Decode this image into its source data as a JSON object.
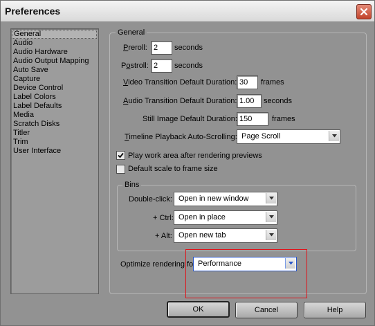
{
  "window": {
    "title": "Preferences"
  },
  "categories": [
    {
      "label": "General",
      "selected": true
    },
    {
      "label": "Audio"
    },
    {
      "label": "Audio Hardware"
    },
    {
      "label": "Audio Output Mapping"
    },
    {
      "label": "Auto Save"
    },
    {
      "label": "Capture"
    },
    {
      "label": "Device Control"
    },
    {
      "label": "Label Colors"
    },
    {
      "label": "Label Defaults"
    },
    {
      "label": "Media"
    },
    {
      "label": "Scratch Disks"
    },
    {
      "label": "Titler"
    },
    {
      "label": "Trim"
    },
    {
      "label": "User Interface"
    }
  ],
  "general": {
    "legend": "General",
    "preroll": {
      "label_u": "P",
      "label_rest": "reroll:",
      "value": "2",
      "unit": "seconds"
    },
    "postroll": {
      "label_u": "o",
      "label_pre": "P",
      "label_rest": "stroll:",
      "value": "2",
      "unit": "seconds"
    },
    "video_transition": {
      "label_u": "V",
      "label_rest": "ideo Transition Default Duration:",
      "value": "30",
      "unit": "frames"
    },
    "audio_transition": {
      "label_u": "A",
      "label_rest": "udio Transition Default Duration:",
      "value": "1.00",
      "unit": "seconds"
    },
    "still_image": {
      "label": "Still Image Default Duration:",
      "value": "150",
      "unit": "frames"
    },
    "timeline_scroll": {
      "label_u": "T",
      "label_rest": "imeline Playback Auto-Scrolling:",
      "value": "Page Scroll"
    },
    "play_work_area": {
      "label": "Play work area after rendering previews",
      "checked": true
    },
    "default_scale": {
      "label": "Default scale to frame size",
      "checked": false
    },
    "bins": {
      "legend": "Bins",
      "double_click": {
        "label": "Double-click:",
        "value": "Open in new window"
      },
      "ctrl": {
        "label": "+ Ctrl:",
        "value": "Open in place"
      },
      "alt": {
        "label": "+ Alt:",
        "value": "Open new tab"
      }
    },
    "optimize": {
      "label": "Optimize rendering for:",
      "value": "Performance"
    }
  },
  "buttons": {
    "ok": "OK",
    "cancel": "Cancel",
    "help": "Help"
  },
  "colors": {
    "dialog_bg": "#929292",
    "highlight": "#e0131a",
    "focus": "#2a57c8"
  }
}
